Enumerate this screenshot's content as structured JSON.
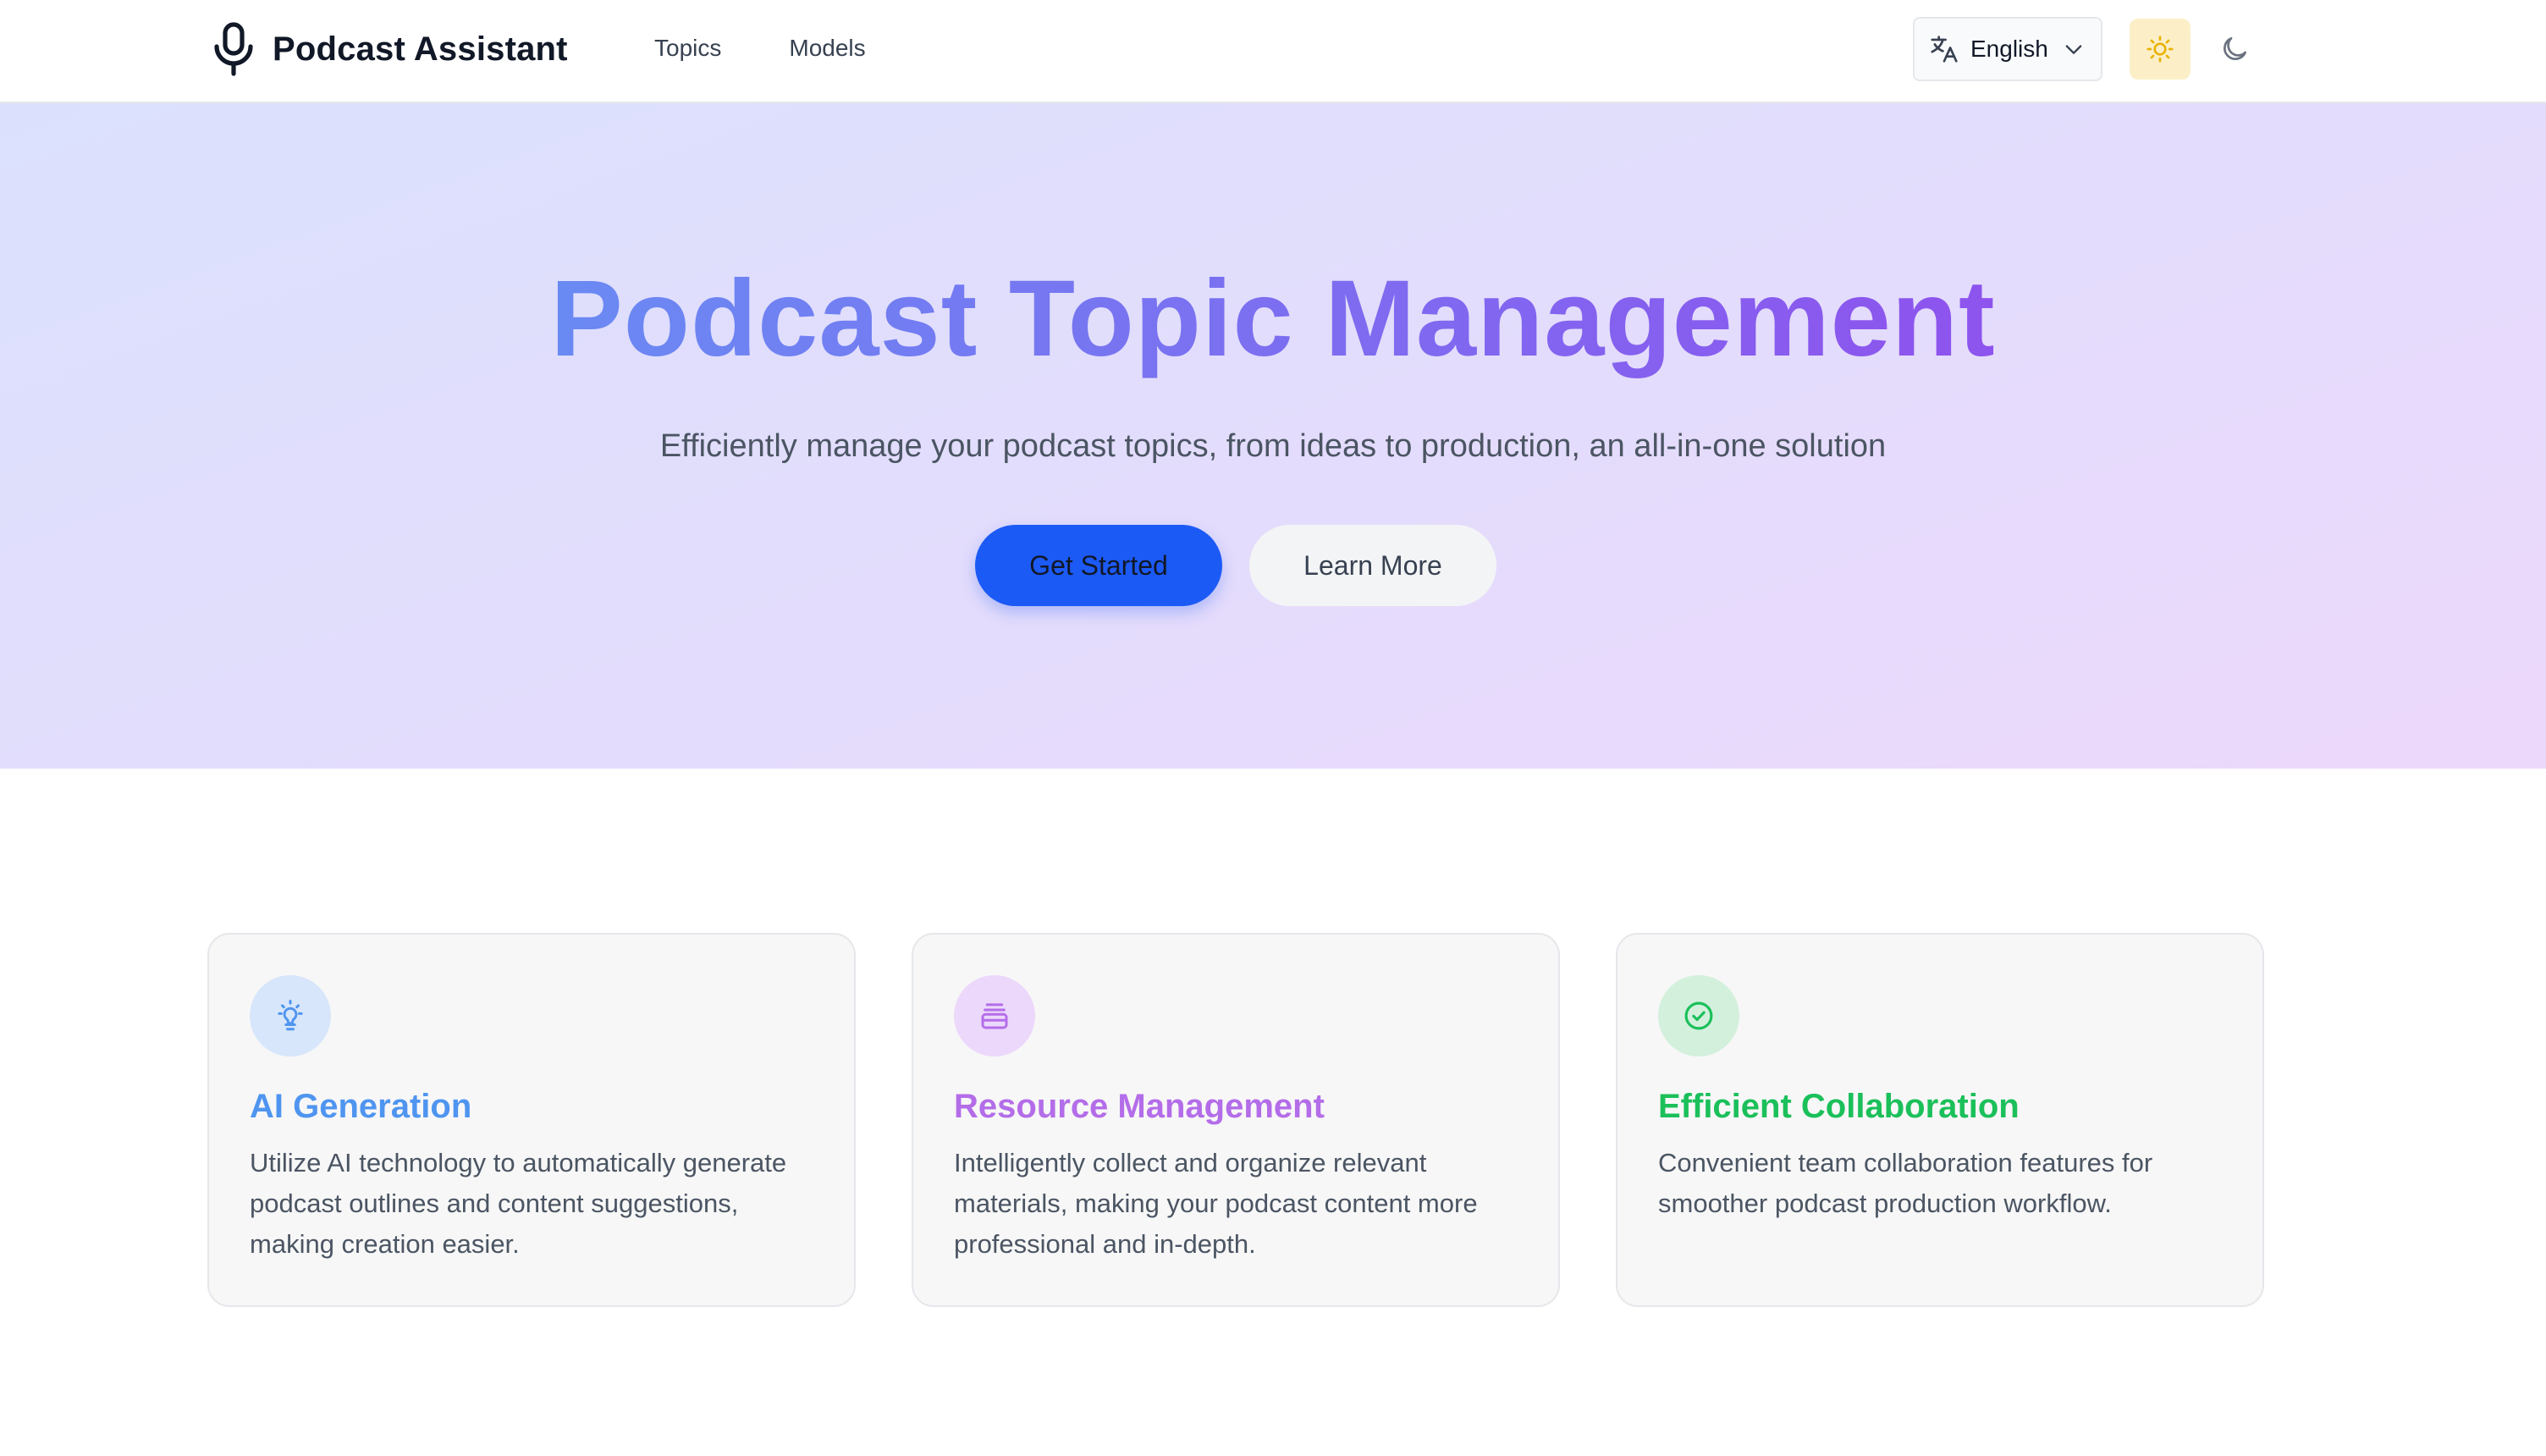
{
  "header": {
    "brand": {
      "title": "Podcast Assistant",
      "icon": "microphone-icon"
    },
    "nav": [
      {
        "label": "Topics"
      },
      {
        "label": "Models"
      }
    ],
    "language": {
      "label": "English",
      "icon": "translate-icon"
    },
    "theme": {
      "light_icon": "sun-icon",
      "dark_icon": "moon-icon",
      "active": "light"
    }
  },
  "hero": {
    "title": "Podcast Topic Management",
    "subtitle": "Efficiently manage your podcast topics, from ideas to production, an all-in-one solution",
    "primary_button": "Get Started",
    "secondary_button": "Learn More"
  },
  "features": [
    {
      "title": "AI Generation",
      "description": "Utilize AI technology to automatically generate podcast outlines and content suggestions, making creation easier.",
      "icon": "lightbulb-icon",
      "color": "#4f95f0",
      "icon_bg": "#d7e6fb"
    },
    {
      "title": "Resource Management",
      "description": "Intelligently collect and organize relevant materials, making your podcast content more professional and in-depth.",
      "icon": "archive-icon",
      "color": "#b46de9",
      "icon_bg": "#ecd8fb"
    },
    {
      "title": "Efficient Collaboration",
      "description": "Convenient team collaboration features for smoother podcast production workflow.",
      "icon": "check-circle-icon",
      "color": "#1bc05a",
      "icon_bg": "#d3f0dd"
    }
  ],
  "colors": {
    "primary": "#1c5af6",
    "title_gradient_start": "#6a8af3",
    "title_gradient_end": "#8e53ee",
    "sun_bg": "#fcefc8"
  }
}
